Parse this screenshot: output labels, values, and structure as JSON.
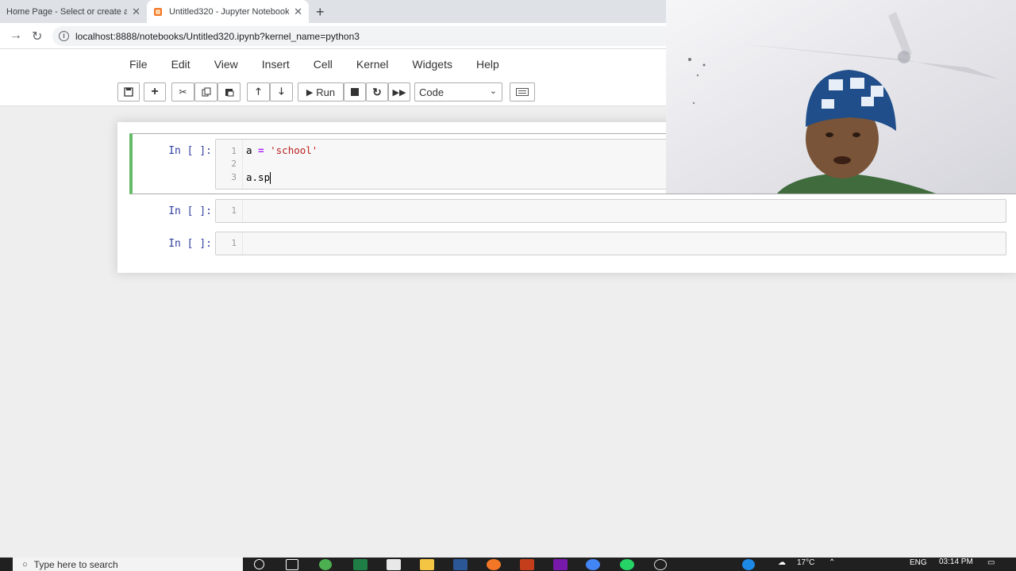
{
  "browser": {
    "tabs": [
      {
        "title": "Home Page - Select or create a n",
        "active": false
      },
      {
        "title": "Untitled320 - Jupyter Notebook",
        "active": true
      }
    ],
    "new_tab_label": "+",
    "url": "localhost:8888/notebooks/Untitled320.ipynb?kernel_name=python3"
  },
  "jupyter": {
    "menu": [
      "File",
      "Edit",
      "View",
      "Insert",
      "Cell",
      "Kernel",
      "Widgets",
      "Help"
    ],
    "toolbar": {
      "run_label": "Run",
      "cell_type": "Code"
    }
  },
  "cells": [
    {
      "prompt": "In [ ]:",
      "lines": [
        "1",
        "2",
        "3"
      ]
    },
    {
      "prompt": "In [ ]:",
      "lines": [
        "1"
      ]
    },
    {
      "prompt": "In [ ]:",
      "lines": [
        "1"
      ]
    }
  ],
  "code": {
    "line1_var": "a",
    "line1_op": "=",
    "line1_str": "'school'",
    "line3": "a.sp"
  },
  "taskbar": {
    "search_placeholder": "Type here to search",
    "weather": "17°C",
    "lang": "ENG",
    "time": "03:14 PM"
  },
  "colors": {
    "selected_cell_border": "#66bb6a",
    "prompt_color": "#303f9f",
    "string_color": "#ba2121",
    "operator_color": "#ab22ff"
  }
}
